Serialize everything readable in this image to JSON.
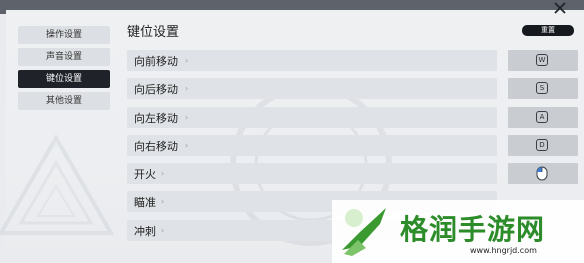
{
  "sidebar": {
    "items": [
      {
        "label": "操作设置"
      },
      {
        "label": "声音设置"
      },
      {
        "label": "键位设置"
      },
      {
        "label": "其他设置"
      }
    ]
  },
  "page": {
    "title": "键位设置"
  },
  "reset_label": "重置",
  "bindings": [
    {
      "action": "向前移动",
      "key": "W"
    },
    {
      "action": "向后移动",
      "key": "S"
    },
    {
      "action": "向左移动",
      "key": "A"
    },
    {
      "action": "向右移动",
      "key": "D"
    },
    {
      "action": "开火",
      "key_icon": "mouse-left-icon"
    },
    {
      "action": "瞄准",
      "key": ""
    },
    {
      "action": "冲刺",
      "key": ""
    }
  ],
  "watermark": {
    "brand": "格润手游网",
    "url": "www.hngrjd.com"
  },
  "colors": {
    "active": "#1f2329",
    "row": "#dfe2e6",
    "key": "#c9cdd2",
    "brand_green": "#2d8c2a"
  }
}
